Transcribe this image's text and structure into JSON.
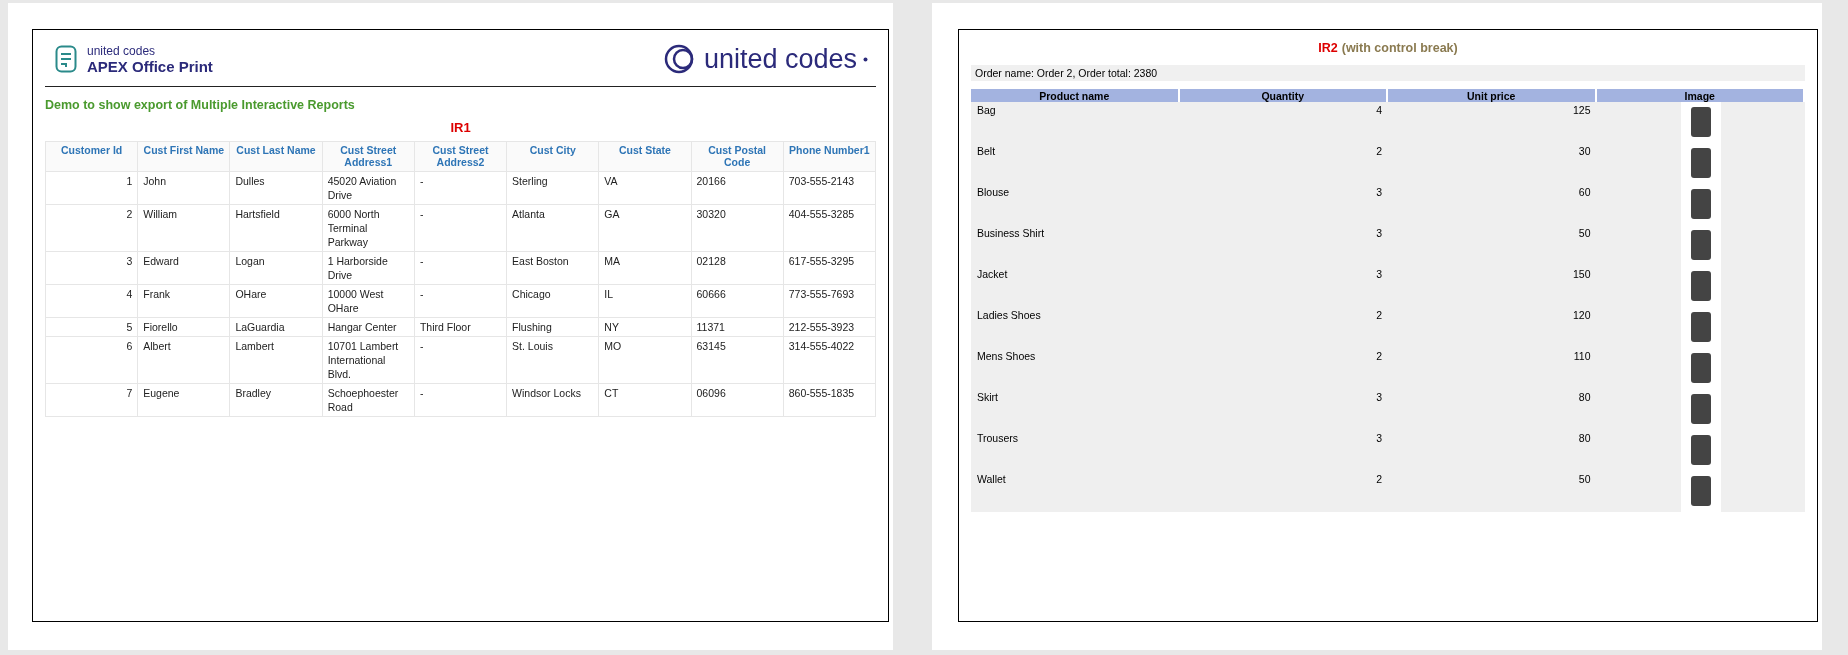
{
  "page_1": {
    "brand": {
      "small": "united codes",
      "product": "APEX Office Print",
      "company": "united codes"
    },
    "heading": "Demo to show export of Multiple Interactive Reports",
    "report_title": "IR1",
    "table": {
      "columns": [
        "Customer Id",
        "Cust First Name",
        "Cust Last Name",
        "Cust Street Address1",
        "Cust Street Address2",
        "Cust City",
        "Cust State",
        "Cust Postal Code",
        "Phone Number1"
      ],
      "rows": [
        [
          "1",
          "John",
          "Dulles",
          "45020 Aviation Drive",
          "-",
          "Sterling",
          "VA",
          "20166",
          "703-555-2143"
        ],
        [
          "2",
          "William",
          "Hartsfield",
          "6000 North Terminal Parkway",
          "-",
          "Atlanta",
          "GA",
          "30320",
          "404-555-3285"
        ],
        [
          "3",
          "Edward",
          "Logan",
          "1 Harborside Drive",
          "-",
          "East Boston",
          "MA",
          "02128",
          "617-555-3295"
        ],
        [
          "4",
          "Frank",
          "OHare",
          "10000 West OHare",
          "-",
          "Chicago",
          "IL",
          "60666",
          "773-555-7693"
        ],
        [
          "5",
          "Fiorello",
          "LaGuardia",
          "Hangar Center",
          "Third Floor",
          "Flushing",
          "NY",
          "11371",
          "212-555-3923"
        ],
        [
          "6",
          "Albert",
          "Lambert",
          "10701 Lambert International Blvd.",
          "-",
          "St. Louis",
          "MO",
          "63145",
          "314-555-4022"
        ],
        [
          "7",
          "Eugene",
          "Bradley",
          "Schoephoester Road",
          "-",
          "Windsor Locks",
          "CT",
          "06096",
          "860-555-1835"
        ]
      ]
    }
  },
  "page_2": {
    "report_title": "IR2",
    "report_subtitle": "(with control break)",
    "break_label": "Order name: Order 2, Order total: 2380",
    "table": {
      "columns": [
        "Product name",
        "Quantity",
        "Unit price",
        "Image"
      ],
      "rows": [
        {
          "product": "Bag",
          "quantity": "4",
          "unit_price": "125"
        },
        {
          "product": "Belt",
          "quantity": "2",
          "unit_price": "30"
        },
        {
          "product": "Blouse",
          "quantity": "3",
          "unit_price": "60"
        },
        {
          "product": "Business Shirt",
          "quantity": "3",
          "unit_price": "50"
        },
        {
          "product": "Jacket",
          "quantity": "3",
          "unit_price": "150"
        },
        {
          "product": "Ladies Shoes",
          "quantity": "2",
          "unit_price": "120"
        },
        {
          "product": "Mens Shoes",
          "quantity": "2",
          "unit_price": "110"
        },
        {
          "product": "Skirt",
          "quantity": "3",
          "unit_price": "80"
        },
        {
          "product": "Trousers",
          "quantity": "3",
          "unit_price": "80"
        },
        {
          "product": "Wallet",
          "quantity": "2",
          "unit_price": "50"
        }
      ]
    }
  }
}
